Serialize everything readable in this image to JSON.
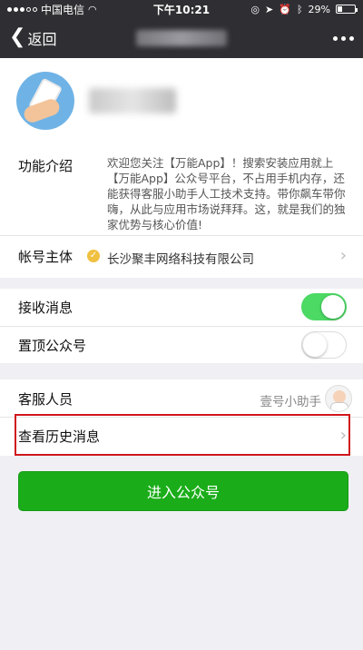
{
  "status_bar": {
    "carrier": "中国电信",
    "time": "下午10:21",
    "battery": "29%",
    "battery_level": 0.29
  },
  "nav": {
    "back_label": "返回"
  },
  "intro": {
    "label": "功能介绍",
    "text": "欢迎您关注【万能App】！搜索安装应用就上【万能App】公众号平台，不占用手机内存，还能获得客服小助手人工技术支持。带你飙车带你嗨，从此与应用市场说拜拜。这，就是我们的独家优势与核心价值!"
  },
  "subject": {
    "label": "帐号主体",
    "value": "长沙聚丰网络科技有限公司"
  },
  "toggles": [
    {
      "label": "接收消息",
      "on": true
    },
    {
      "label": "置顶公众号",
      "on": false
    }
  ],
  "service": {
    "label": "客服人员",
    "value": "壹号小助手"
  },
  "history": {
    "label": "查看历史消息"
  },
  "enter_button": "进入公众号",
  "colors": {
    "topbar": "#2f2f33",
    "switch_on": "#4cd964",
    "primary_button": "#1aad19",
    "highlight_border": "#d0161c"
  }
}
